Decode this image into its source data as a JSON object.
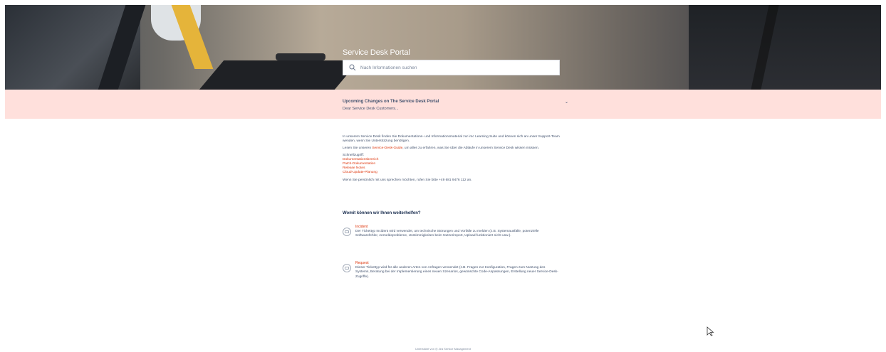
{
  "portal": {
    "title": "Service Desk Portal",
    "search_placeholder": "Nach Informationen suchen"
  },
  "announcement": {
    "title": "Upcoming Changes on The Service Desk Portal",
    "text": "Dear Service Desk Customers...",
    "toggle": "⌄"
  },
  "intro": {
    "paragraph1": "In unserem Service Desk finden Sie Dokumentations- und Informationsmaterial zur imc Learning Suite und können sich an unser Support-Team wenden, wenn Sie Unterstützung benötigen.",
    "paragraph2_before": "Lesen Sie unseren ",
    "paragraph2_link": "Service-Desk-Guide",
    "paragraph2_after": ", um alles zu erfahren, was Sie über die Abläufe in unserem Service Desk wissen müssen.",
    "quick_access_label": "Schnellzugriff:",
    "quick_links": [
      "Dokumentationsbereich",
      "Patch-Dokumentation",
      "Release Notes",
      "Cloud-Update-Planung"
    ],
    "phone_text": "Wenn Sie persönlich mit uns sprechen möchten, rufen Sie bitte +49 681 9476 112 an."
  },
  "help": {
    "heading": "Womit können wir Ihnen weiterhelfen?",
    "types": [
      {
        "title": "Incident",
        "description": "Der Tickettyp Incident wird verwendet, um technische Störungen und Vorfälle zu melden (z.B. Systemausfälle, potenzielle Softwarefehler, Anmeldeprobleme, Unstimmigkeiten beim Nutzerimport, Upload funktioniert nicht usw.)."
      },
      {
        "title": "Request",
        "description": "Dieser Tickettyp wird für alle anderen Arten von Anfragen verwendet (z.B. Fragen zur Konfiguration, Fragen zum Nutzung des Systems, Beratung bei der Implementierung eines neuen Szenarios, gewünschte Code-Anpassungen, Erstellung neuer Service-Desk-Zugriffe)."
      }
    ]
  },
  "footer": {
    "text": "Unterstützt von ◎ Jira Service Management"
  },
  "colors": {
    "announcement_bg": "#ffe0dc",
    "link": "#de350b",
    "text": "#42526e"
  }
}
